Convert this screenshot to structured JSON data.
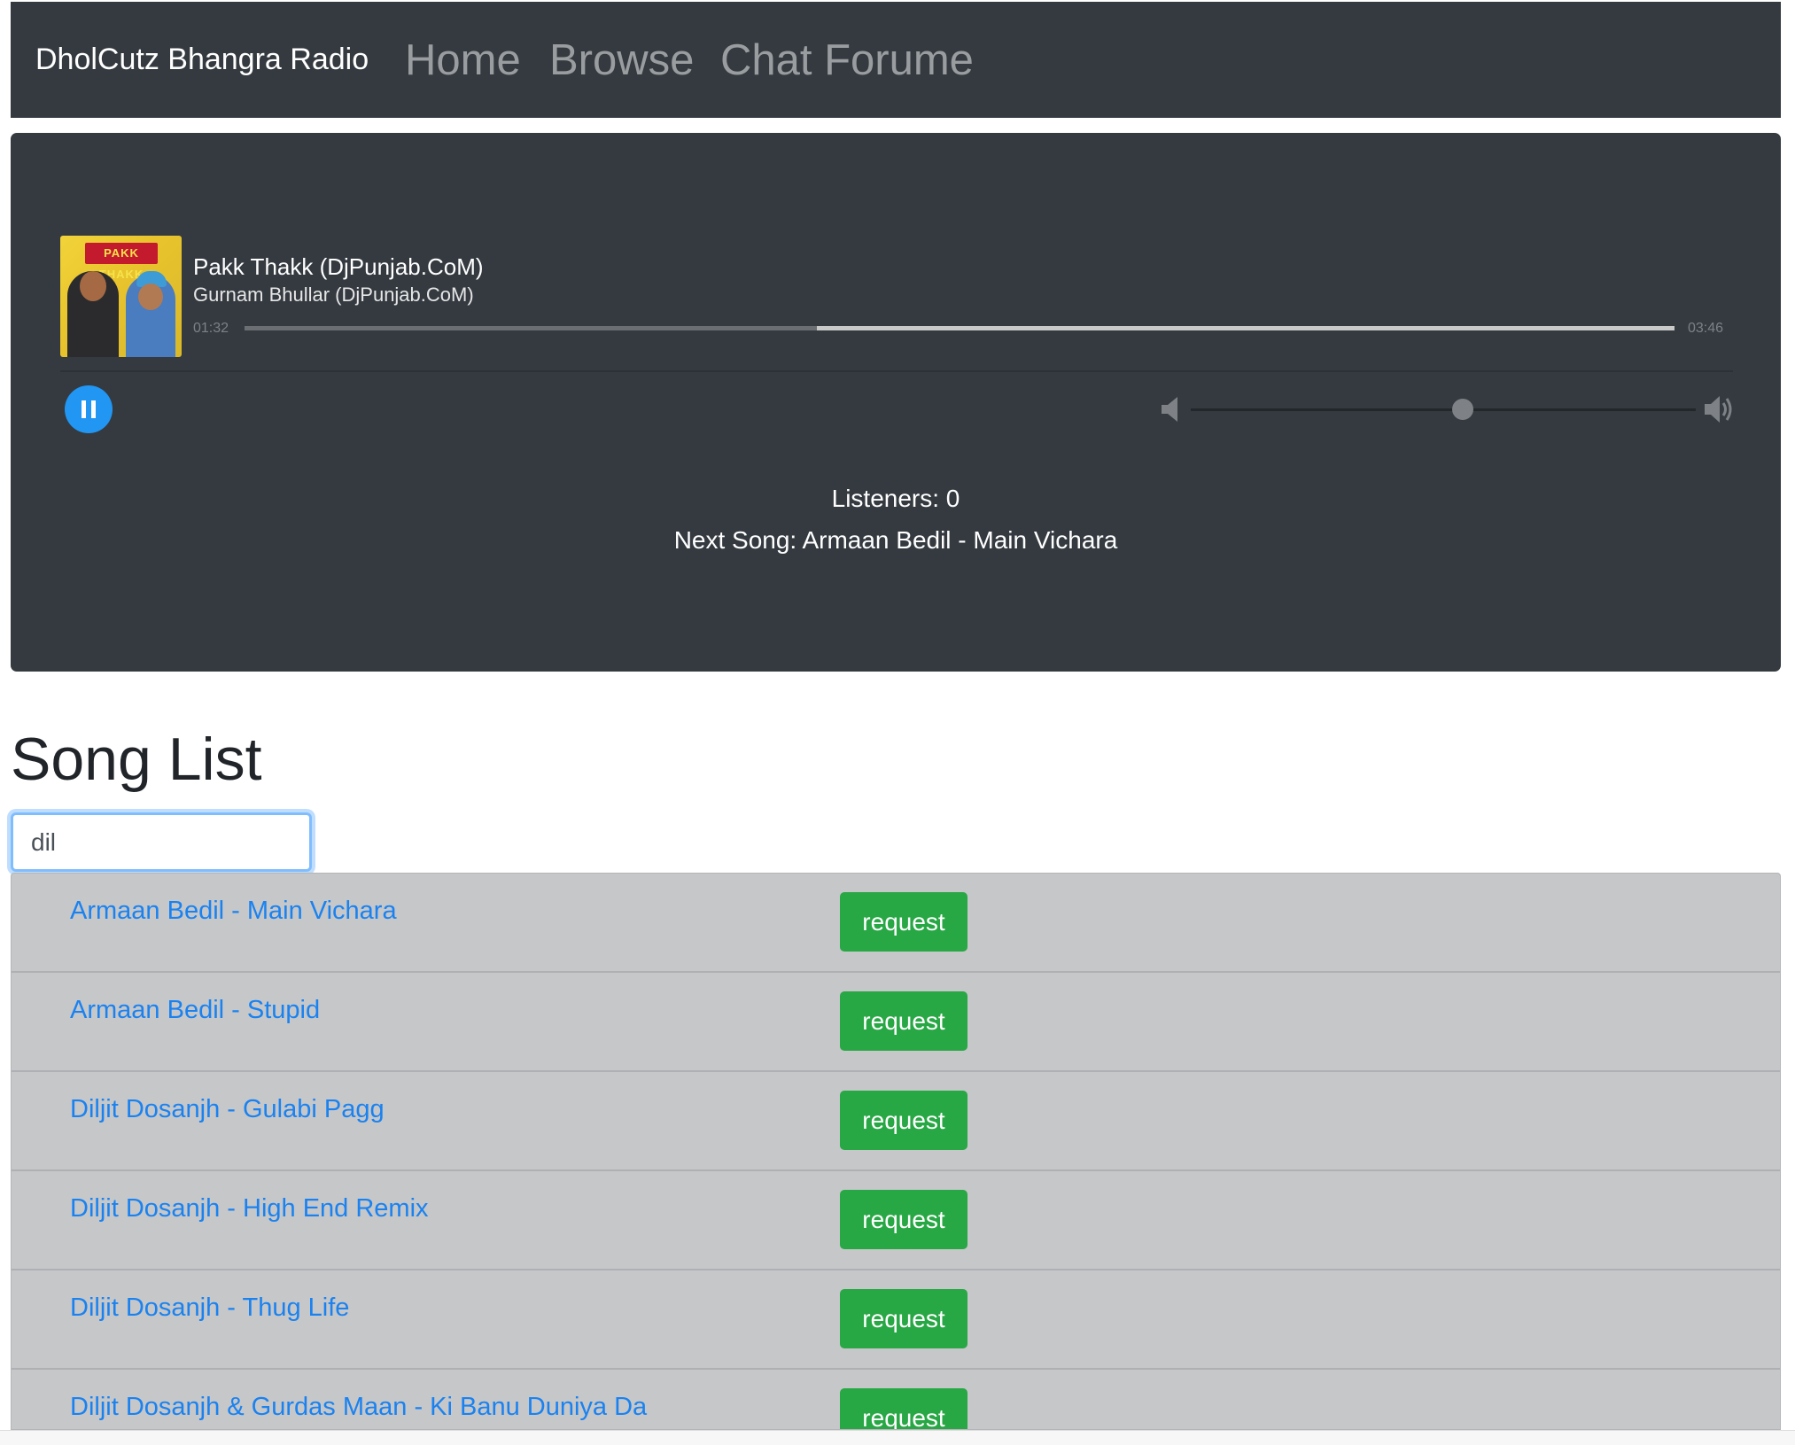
{
  "navbar": {
    "brand": "DholCutz Bhangra Radio",
    "links": [
      "Home",
      "Browse",
      "Chat Forume"
    ]
  },
  "player": {
    "album_art_text": "PAKK THAKK",
    "title": "Pakk Thakk (DjPunjab.CoM)",
    "artist": "Gurnam Bhullar (DjPunjab.CoM)",
    "elapsed": "01:32",
    "duration": "03:46",
    "progress_fraction": 0.4,
    "volume_fraction": 0.55,
    "state": "playing",
    "accent_color": "#2196f3"
  },
  "station": {
    "listeners": "Listeners: 0",
    "next_song": "Next Song: Armaan Bedil - Main Vichara"
  },
  "song_list": {
    "heading": "Song List",
    "search_value": "dil",
    "request_label": "request",
    "songs": [
      "Armaan Bedil - Main Vichara",
      "Armaan Bedil - Stupid",
      "Diljit Dosanjh - Gulabi Pagg",
      "Diljit Dosanjh - High End Remix",
      "Diljit Dosanjh - Thug Life",
      "Diljit Dosanjh & Gurdas Maan - Ki Banu Duniya Da"
    ]
  },
  "colors": {
    "navbar_bg": "#343a40",
    "link_blue": "#1a82f0",
    "request_green": "#28a745",
    "list_bg": "#c6c7c9"
  }
}
